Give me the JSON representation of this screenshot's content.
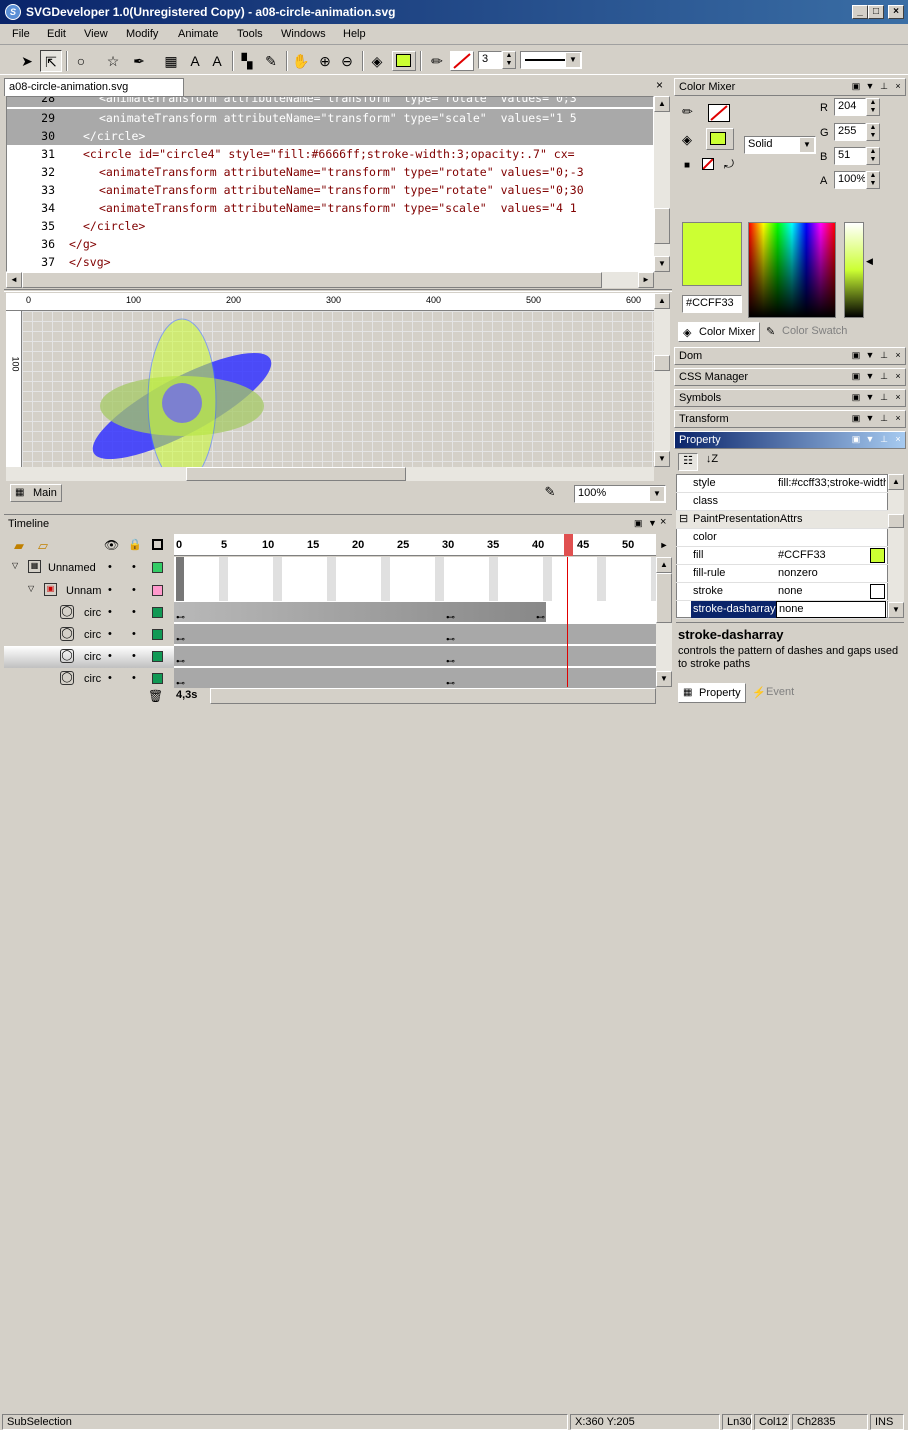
{
  "window": {
    "title": "SVGDeveloper 1.0(Unregistered Copy) - a08-circle-animation.svg",
    "icon": "svgdeveloper-app-icon"
  },
  "menu": [
    "File",
    "Edit",
    "View",
    "Modify",
    "Animate",
    "Tools",
    "Windows",
    "Help"
  ],
  "toolbar": {
    "stroke_width": "3"
  },
  "editor": {
    "tab": "a08-circle-animation.svg",
    "lines": [
      {
        "n": "28",
        "t": "<animateTransform attributeName=\"transform\" type=\"rotate\" values=\"0;3"
      },
      {
        "n": "29",
        "t": "<animateTransform attributeName=\"transform\" type=\"scale\"  values=\"1 5"
      },
      {
        "n": "30",
        "t": "</circle>"
      },
      {
        "n": "31",
        "t": "<circle id=\"circle4\" style=\"fill:#6666ff;stroke-width:3;opacity:.7\" cx="
      },
      {
        "n": "32",
        "t": "<animateTransform attributeName=\"transform\" type=\"rotate\" values=\"0;-3"
      },
      {
        "n": "33",
        "t": "<animateTransform attributeName=\"transform\" type=\"rotate\" values=\"0;30"
      },
      {
        "n": "34",
        "t": "<animateTransform attributeName=\"transform\" type=\"scale\"  values=\"4 1"
      },
      {
        "n": "35",
        "t": "</circle>"
      },
      {
        "n": "36",
        "t": "</g>"
      },
      {
        "n": "37",
        "t": "</svg>"
      }
    ]
  },
  "canvas": {
    "hruler": [
      "0",
      "100",
      "200",
      "300",
      "400",
      "500",
      "600"
    ],
    "vruler": [
      "100"
    ],
    "layer_tab": "Main",
    "zoom": "100%"
  },
  "timeline": {
    "title": "Timeline",
    "frames": [
      "0",
      "5",
      "10",
      "15",
      "20",
      "25",
      "30",
      "35",
      "40",
      "45",
      "50"
    ],
    "time": "4,3s",
    "rows": [
      {
        "name": "Unnamed",
        "color": "#33cc66"
      },
      {
        "name": "Unnam",
        "color": "#ff99cc"
      },
      {
        "name": "circ",
        "color": "#119955"
      },
      {
        "name": "circ",
        "color": "#119955"
      },
      {
        "name": "circ",
        "color": "#119955"
      },
      {
        "name": "circ",
        "color": "#119955"
      }
    ]
  },
  "color_mixer": {
    "title": "Color Mixer",
    "r": "204",
    "g": "255",
    "b": "51",
    "a": "100%",
    "r_label": "R",
    "g_label": "G",
    "b_label": "B",
    "a_label": "A",
    "fill_type": "Solid",
    "hex": "#CCFF33",
    "tab1": "Color Mixer",
    "tab2": "Color Swatch",
    "swatch": "#ccff33"
  },
  "panels": [
    "Dom",
    "CSS Manager",
    "Symbols",
    "Transform",
    "Property"
  ],
  "property": {
    "rows": [
      {
        "k": "style",
        "v": "fill:#ccff33;stroke-width"
      },
      {
        "k": "class",
        "v": ""
      },
      {
        "k": "PaintPresentationAttrs",
        "v": "",
        "group": true
      },
      {
        "k": "color",
        "v": ""
      },
      {
        "k": "fill",
        "v": "#CCFF33"
      },
      {
        "k": "fill-rule",
        "v": "nonzero"
      },
      {
        "k": "stroke",
        "v": "none"
      },
      {
        "k": "stroke-dasharray",
        "v": "none",
        "selected": true
      }
    ],
    "help_title": "stroke-dasharray",
    "help_text": "controls the pattern of dashes and gaps used to stroke paths",
    "tab1": "Property",
    "tab2": "Event"
  },
  "status": {
    "mode": "SubSelection",
    "xy": "X:360  Y:205",
    "ln": "Ln30",
    "col": "Col12",
    "ch": "Ch2835",
    "ins": "INS"
  }
}
